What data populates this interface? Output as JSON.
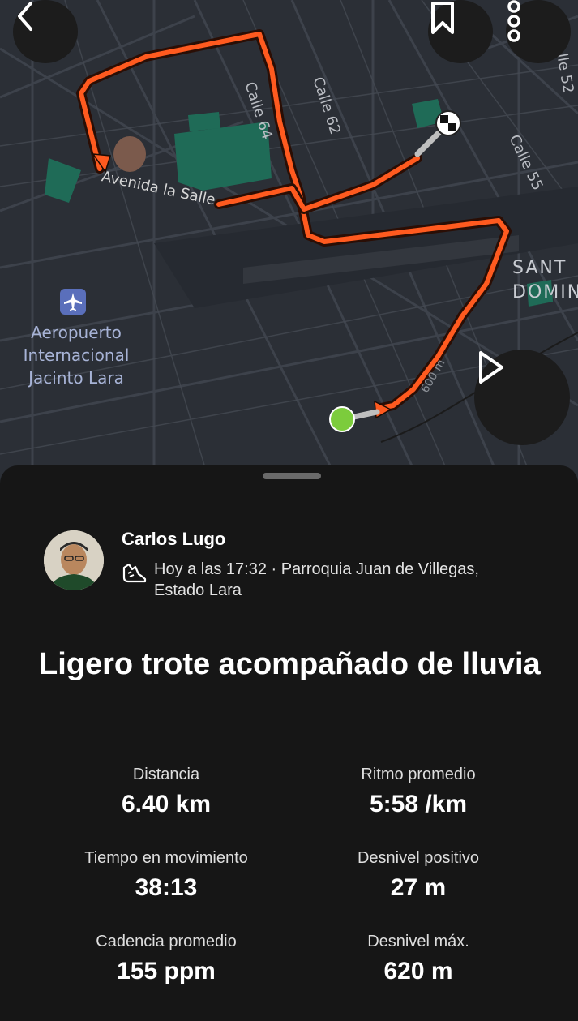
{
  "map": {
    "street_labels": [
      "Calle 64",
      "Calle 62",
      "Calle 55",
      "lle 52",
      "Avenida la Salle"
    ],
    "district_label_line1": "SANT",
    "district_label_line2": "DOMIN",
    "airport_label": [
      "Aeropuerto",
      "Internacional",
      "Jacinto Lara"
    ],
    "scale_label": "600 m",
    "route_color": "#ff5a1f",
    "start_marker_color": "#7ccc3c"
  },
  "buttons": {
    "back_icon": "chevron-left-icon",
    "bookmark_icon": "bookmark-icon",
    "more_icon": "more-vertical-icon",
    "play_icon": "play-icon"
  },
  "activity": {
    "user_name": "Carlos Lugo",
    "activity_type_icon": "running-shoe-icon",
    "meta_line1": "Hoy a las 17:32 · Parroquia Juan de Villegas,",
    "meta_line2": "Estado Lara",
    "title": "Ligero trote acompañado de lluvia"
  },
  "stats": [
    {
      "label": "Distancia",
      "value": "6.40 km"
    },
    {
      "label": "Ritmo promedio",
      "value": "5:58 /km"
    },
    {
      "label": "Tiempo en movimiento",
      "value": "38:13"
    },
    {
      "label": "Desnivel positivo",
      "value": "27 m"
    },
    {
      "label": "Cadencia promedio",
      "value": "155 ppm"
    },
    {
      "label": "Desnivel máx.",
      "value": "620 m"
    }
  ]
}
